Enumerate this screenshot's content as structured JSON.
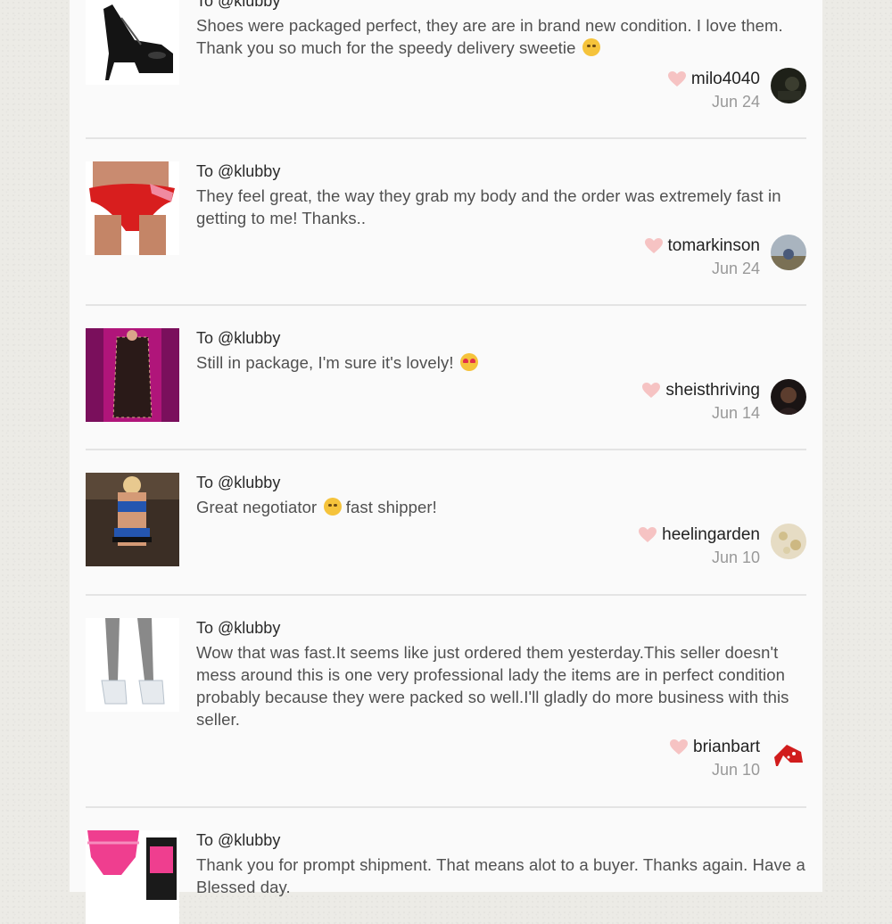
{
  "reviews": [
    {
      "to": "To @klubby",
      "text": "Shoes were packaged perfect, they are are in brand new condition. I love them. Thank you so much for the speedy delivery sweetie",
      "emoji": "smiling-face-icon",
      "user": "milo4040",
      "date": "Jun 24"
    },
    {
      "to": "To @klubby",
      "text": "They feel great, the way they grab my body and the order was extremely fast in getting to me! Thanks..",
      "user": "tomarkinson",
      "date": "Jun 24"
    },
    {
      "to": "To @klubby",
      "text": "Still in package, I'm sure it's lovely!",
      "emoji": "heart-eyes-face-icon",
      "user": "sheisthriving",
      "date": "Jun 14"
    },
    {
      "to": "To @klubby",
      "text_before": "Great negotiator",
      "emoji": "winking-kiss-face-icon",
      "text_after": "fast shipper!",
      "user": "heelingarden",
      "date": "Jun 10"
    },
    {
      "to": "To @klubby",
      "text": "Wow that was fast.It seems like just ordered them yesterday.This seller doesn't mess around this is one very professional lady the items are in perfect condition probably because they were packed so well.I'll gladly do more business with this seller.",
      "user": "brianbart",
      "date": "Jun 10"
    },
    {
      "to": "To @klubby",
      "text": "Thank you for prompt shipment. That means alot to a buyer. Thanks again. Have a Blessed day."
    }
  ],
  "colors": {
    "heart": "#f6c3c3",
    "panel": "#fafafa",
    "background": "#ecebe6"
  }
}
